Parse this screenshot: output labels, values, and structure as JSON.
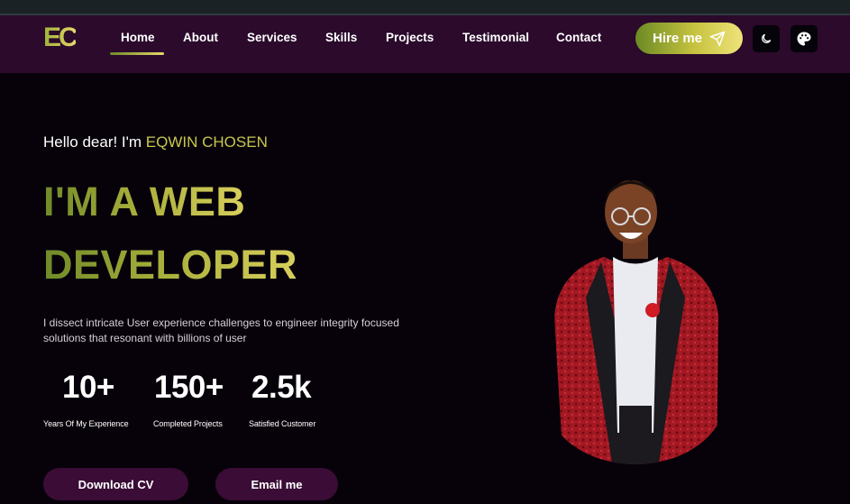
{
  "nav": {
    "logo": "EC",
    "links": [
      "Home",
      "About",
      "Services",
      "Skills",
      "Projects",
      "Testimonial",
      "Contact"
    ],
    "active": "Home",
    "hire_label": "Hire me",
    "hire_icon": "send-icon",
    "theme_icon": "moon-icon",
    "palette_icon": "palette-icon"
  },
  "hero": {
    "greeting": "Hello dear! I'm ",
    "name": "EQWIN CHOSEN",
    "title_line1": "I'M A WEB",
    "title_line2": "DEVELOPER",
    "description": "I dissect intricate User experience challenges to engineer integrity focused solutions that resonant with billions of user",
    "stats": [
      {
        "value": "10+",
        "label": "Years Of My Experience"
      },
      {
        "value": "150+",
        "label": "Completed Projects"
      },
      {
        "value": "2.5k",
        "label": "Satisfied Customer"
      }
    ],
    "buttons": {
      "download": "Download CV",
      "email": "Email me"
    }
  },
  "colors": {
    "navbar": "#2b0a2b",
    "background": "#07020a",
    "accent_green": "#9fb23a",
    "accent_yellow": "#e7d76a",
    "button_purple": "#3a0c36"
  }
}
